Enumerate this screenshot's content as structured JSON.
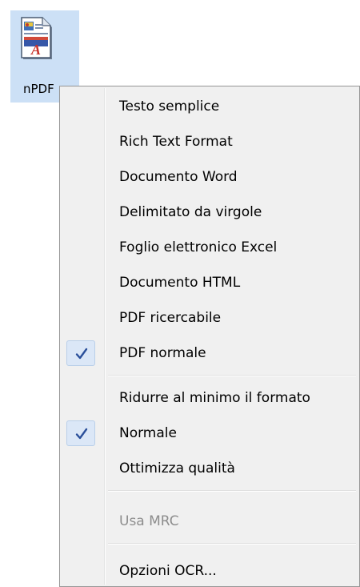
{
  "desktop": {
    "file_label": "nPDF"
  },
  "menu": {
    "items": [
      {
        "label": "Testo semplice",
        "checked": false,
        "disabled": false
      },
      {
        "label": "Rich Text Format",
        "checked": false,
        "disabled": false
      },
      {
        "label": "Documento Word",
        "checked": false,
        "disabled": false
      },
      {
        "label": "Delimitato da virgole",
        "checked": false,
        "disabled": false
      },
      {
        "label": "Foglio elettronico Excel",
        "checked": false,
        "disabled": false
      },
      {
        "label": "Documento HTML",
        "checked": false,
        "disabled": false
      },
      {
        "label": "PDF ricercabile",
        "checked": false,
        "disabled": false
      },
      {
        "label": "PDF normale",
        "checked": true,
        "disabled": false
      },
      {
        "label": "Ridurre al minimo il formato",
        "checked": false,
        "disabled": false
      },
      {
        "label": "Normale",
        "checked": true,
        "disabled": false
      },
      {
        "label": "Ottimizza qualità",
        "checked": false,
        "disabled": false
      },
      {
        "label": "Usa MRC",
        "checked": false,
        "disabled": true
      },
      {
        "label": "Opzioni OCR...",
        "checked": false,
        "disabled": false
      }
    ]
  },
  "colors": {
    "menu_background": "#f0f0f0",
    "check_highlight": "#dbe7f7",
    "check_mark": "#2a4f9a",
    "selection_tile": "#cce0f6",
    "disabled_text": "#8d8d8d"
  }
}
